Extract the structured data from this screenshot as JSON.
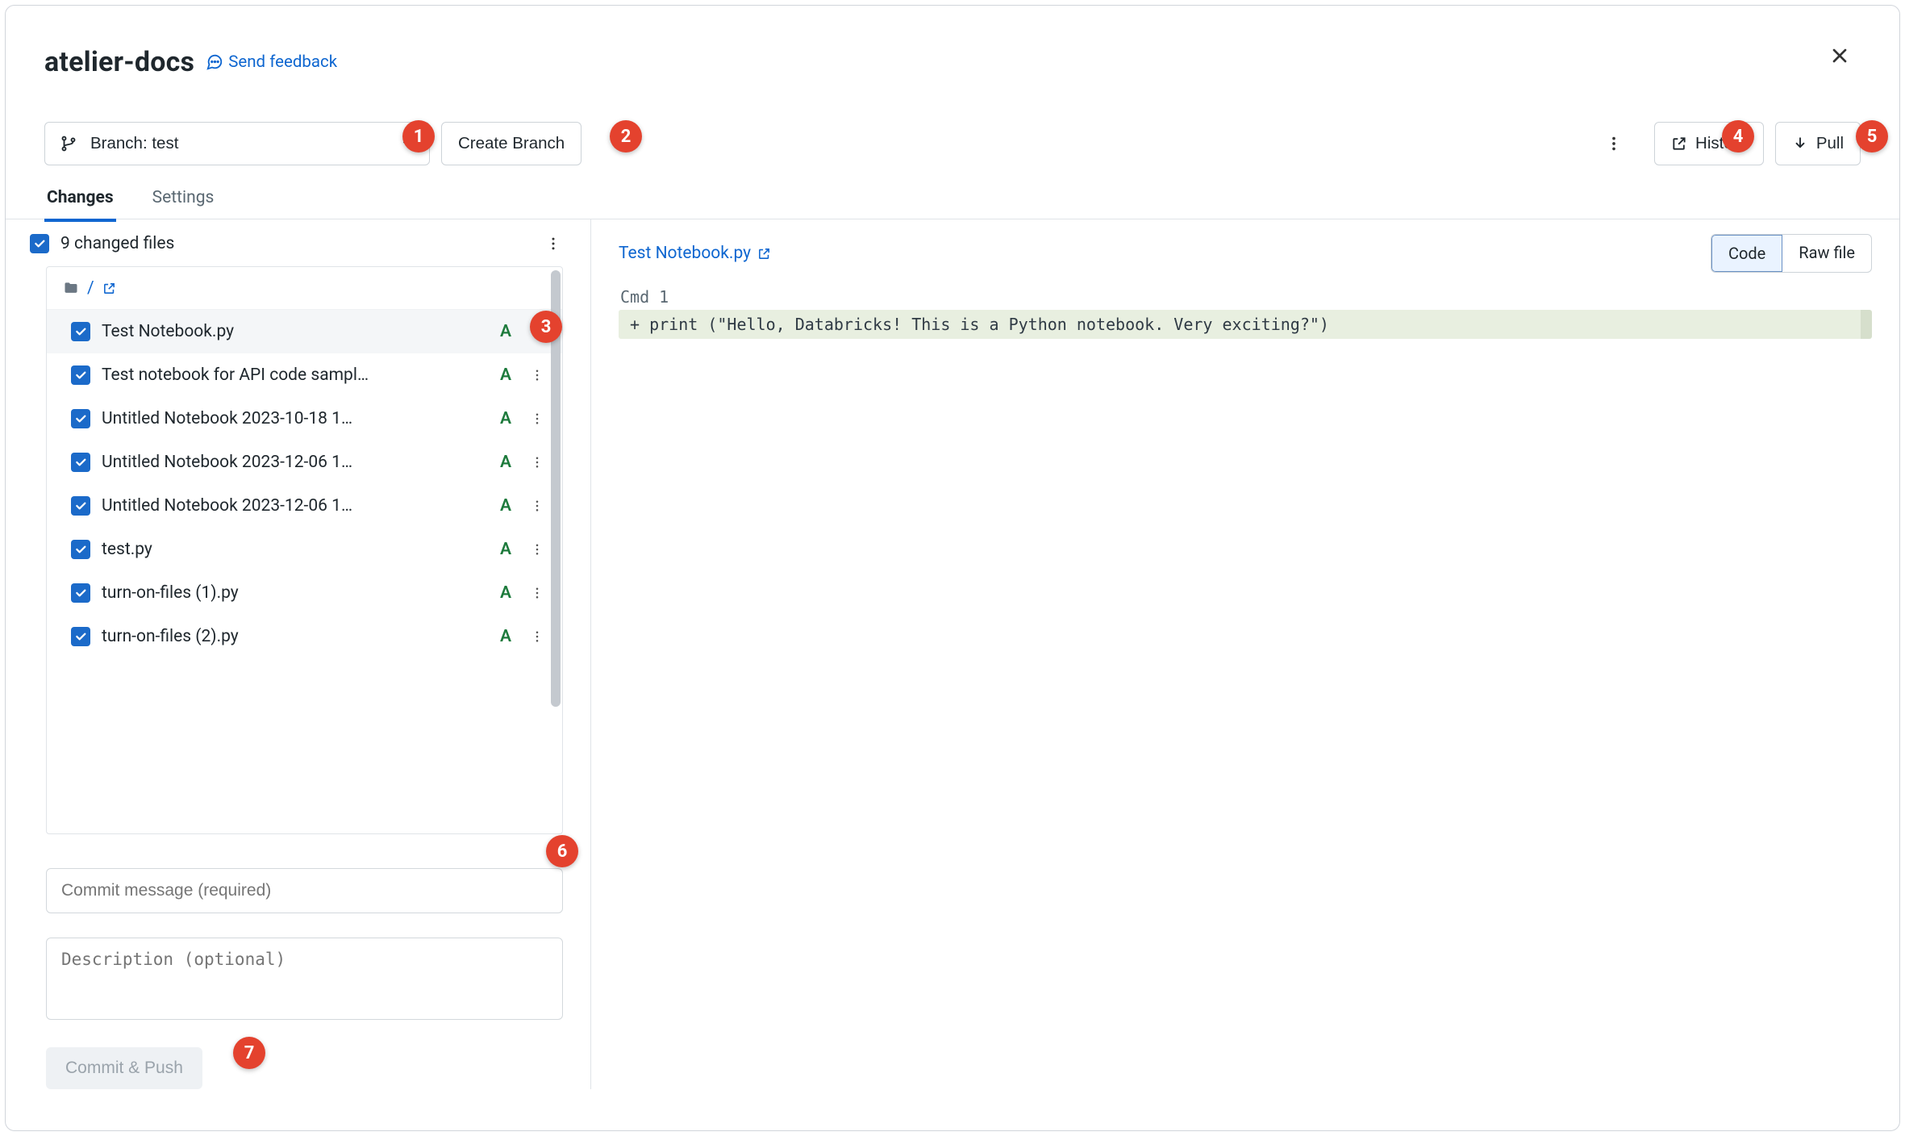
{
  "header": {
    "title": "atelier-docs",
    "feedback": "Send feedback"
  },
  "toolbar": {
    "branch_label": "Branch: test",
    "create_branch": "Create Branch",
    "history": "History",
    "pull": "Pull"
  },
  "tabs": {
    "changes": "Changes",
    "settings": "Settings"
  },
  "files_header": {
    "summary": "9 changed files"
  },
  "crumb_slash": "/",
  "files": [
    {
      "name": "Test Notebook.py",
      "status": "A"
    },
    {
      "name": "Test notebook for API code sampl…",
      "status": "A"
    },
    {
      "name": "Untitled Notebook 2023-10-18 1…",
      "status": "A"
    },
    {
      "name": "Untitled Notebook 2023-12-06 1…",
      "status": "A"
    },
    {
      "name": "Untitled Notebook 2023-12-06 1…",
      "status": "A"
    },
    {
      "name": "test.py",
      "status": "A"
    },
    {
      "name": "turn-on-files (1).py",
      "status": "A"
    },
    {
      "name": "turn-on-files (2).py",
      "status": "A"
    }
  ],
  "commit": {
    "msg_ph": "Commit message (required)",
    "desc_ph": "Description (optional)",
    "button": "Commit & Push"
  },
  "diff": {
    "filename": "Test Notebook.py",
    "seg_code": "Code",
    "seg_raw": "Raw file",
    "cmd_label": "Cmd 1",
    "added_line": "+ print (\"Hello, Databricks! This is a Python notebook. Very exciting?\")"
  },
  "annotations": [
    "1",
    "2",
    "3",
    "4",
    "5",
    "6",
    "7"
  ]
}
